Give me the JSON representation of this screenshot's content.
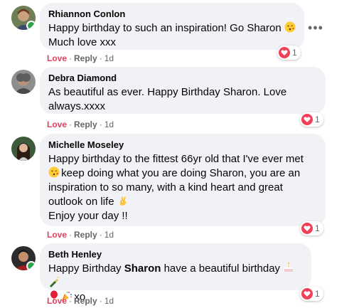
{
  "comments": [
    {
      "author": "Rhiannon Conlon",
      "text_line1": "Happy birthday to such an inspiration! Go Sharon",
      "text_line2": "Much love xxx",
      "actions": {
        "love": "Love",
        "reply": "Reply",
        "time": "1d"
      },
      "reaction_count": "1",
      "online": true
    },
    {
      "author": "Debra Diamond",
      "text_line1": "As beautiful as ever. Happy Birthday Sharon. Love",
      "text_line2": "always.xxxx",
      "actions": {
        "love": "Love",
        "reply": "Reply",
        "time": "1d"
      },
      "reaction_count": "1",
      "online": false
    },
    {
      "author": "Michelle Moseley",
      "text_line1": "Happy birthday to the fittest 66yr old that I've ever met",
      "text_line2": "keep doing what you are doing Sharon, you are an",
      "text_line3": "inspiration to so many, with a kind heart and great",
      "text_line4": "outlook on life",
      "text_line5": "Enjoy your day !!",
      "actions": {
        "love": "Love",
        "reply": "Reply",
        "time": "1d"
      },
      "reaction_count": "1",
      "online": false
    },
    {
      "author": "Beth Henley",
      "text_prefix": "Happy Birthday ",
      "text_bold": "Sharon",
      "text_suffix": " have a beautiful birthday",
      "text_line2": "xo",
      "actions": {
        "love": "Love",
        "reply": "Reply",
        "time": "1d"
      },
      "reaction_count": "1",
      "online": true
    }
  ],
  "more_icon": "ellipsis-icon",
  "colors": {
    "bubble": "#f0f2f5",
    "love": "#e4405f",
    "heart": "#f33e58",
    "meta": "#65676b",
    "online": "#31a24c"
  }
}
